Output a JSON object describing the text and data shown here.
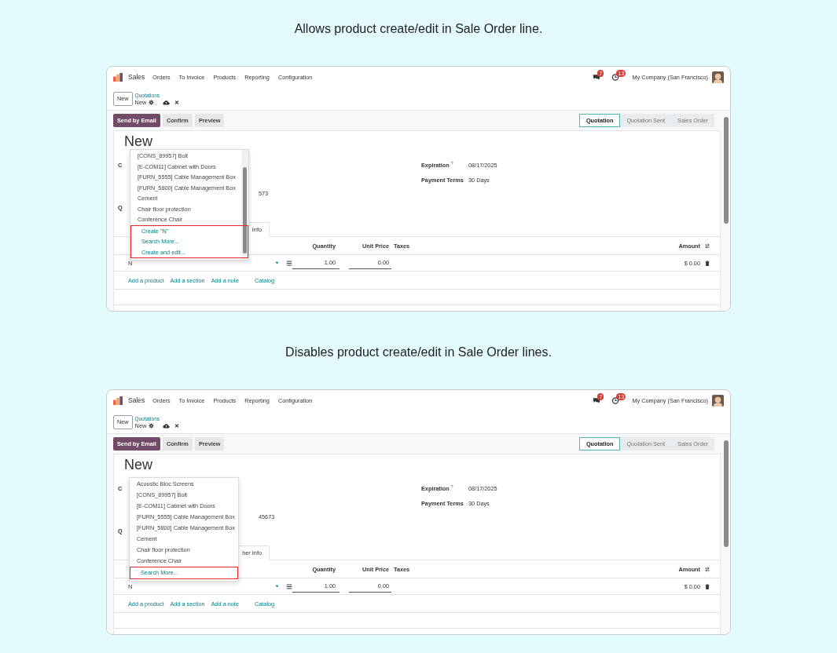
{
  "panels": [
    {
      "caption": "Allows product create/edit in Sale Order line.",
      "screen": {
        "navbar": {
          "app": "Sales",
          "menu": [
            "Orders",
            "To Invoice",
            "Products",
            "Reporting",
            "Configuration"
          ],
          "chat_badge": "7",
          "activity_badge": "13",
          "company": "My Company (San Francisco)"
        },
        "breadcrumb": {
          "new_button": "New",
          "parent": "Quotations",
          "current": "New"
        },
        "actions": [
          {
            "label": "Send by Email",
            "primary": true
          },
          {
            "label": "Confirm",
            "primary": false
          },
          {
            "label": "Preview",
            "primary": false
          }
        ],
        "statusbar": [
          {
            "label": "Quotation",
            "selected": true
          },
          {
            "label": "Quotation Sent",
            "selected": false
          },
          {
            "label": "Sales Order",
            "selected": false
          }
        ],
        "form": {
          "title": "New",
          "customer_fragment": "C",
          "address_fragment": "573",
          "section_fragment": "Q",
          "expiration_label": "Expiration",
          "expiration_help": "?",
          "expiration": "08/17/2025",
          "payment_terms_label": "Payment Terms",
          "payment_terms": "30 Days",
          "tab_fragment": "Info",
          "columns": [
            "Quantity",
            "Unit Price",
            "Taxes",
            "Amount"
          ],
          "line": {
            "product": "N",
            "quantity": "1.00",
            "unit_price": "0.00",
            "amount": "$ 0.00"
          },
          "add_links": [
            "Add a product",
            "Add a section",
            "Add a note",
            "Catalog"
          ]
        },
        "dropdown": {
          "scrollbar": true,
          "products": [
            "[CONS_89957] Bolt",
            "[E-COM11] Cabinet with Doors",
            "[FURN_5555] Cable Management Box",
            "[FURN_5800] Cable Management Box",
            "Cement",
            "Chair floor protection",
            "Conference Chair"
          ],
          "actions": [
            "Create \"N\"",
            "Search More...",
            "Create and edit..."
          ]
        }
      }
    },
    {
      "caption": "Disables product create/edit in Sale Order lines.",
      "screen": {
        "navbar": {
          "app": "Sales",
          "menu": [
            "Orders",
            "To Invoice",
            "Products",
            "Reporting",
            "Configuration"
          ],
          "chat_badge": "7",
          "activity_badge": "13",
          "company": "My Company (San Francisco)"
        },
        "breadcrumb": {
          "new_button": "New",
          "parent": "Quotations",
          "current": "New"
        },
        "actions": [
          {
            "label": "Send by Email",
            "primary": true
          },
          {
            "label": "Confirm",
            "primary": false
          },
          {
            "label": "Preview",
            "primary": false
          }
        ],
        "statusbar": [
          {
            "label": "Quotation",
            "selected": true
          },
          {
            "label": "Quotation Sent",
            "selected": false
          },
          {
            "label": "Sales Order",
            "selected": false
          }
        ],
        "form": {
          "title": "New",
          "customer_fragment": "C",
          "address_fragment": "45673",
          "section_fragment": "Q",
          "expiration_label": "Expiration",
          "expiration_help": "?",
          "expiration": "08/17/2025",
          "payment_terms_label": "Payment Terms",
          "payment_terms": "30 Days",
          "tab_fragment": "her Info",
          "columns": [
            "Quantity",
            "Unit Price",
            "Taxes",
            "Amount"
          ],
          "line": {
            "product": "N",
            "quantity": "1.00",
            "unit_price": "0.00",
            "amount": "$ 0.00"
          },
          "add_links": [
            "Add a product",
            "Add a section",
            "Add a note",
            "Catalog"
          ]
        },
        "dropdown": {
          "scrollbar": false,
          "products": [
            "Acoustic Bloc Screens",
            "[CONS_89957] Bolt",
            "[E-COM11] Cabinet with Doors",
            "[FURN_5555] Cable Management Box",
            "[FURN_5800] Cable Management Box",
            "Cement",
            "Chair floor protection",
            "Conference Chair"
          ],
          "actions": [
            "Search More..."
          ]
        }
      }
    }
  ]
}
